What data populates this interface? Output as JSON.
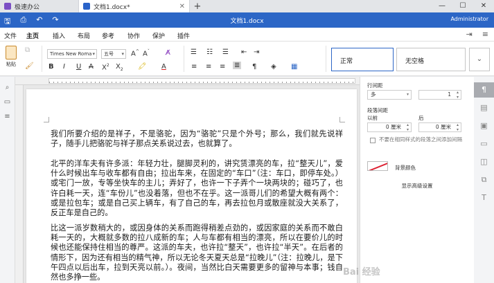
{
  "tabs": {
    "app_tab": "极速办公",
    "doc_tab": "文档1.docx*",
    "new_tab": "+"
  },
  "window": {
    "minimize": "—",
    "maximize": "☐",
    "close": "✕"
  },
  "titlebar": {
    "title": "文档1.docx",
    "user": "Administrator"
  },
  "menu": {
    "items": [
      "文件",
      "主页",
      "插入",
      "布局",
      "参考",
      "协作",
      "保护",
      "插件"
    ],
    "active_index": 1
  },
  "ribbon": {
    "paste_label": "粘贴",
    "font_name": "Times New Roma",
    "font_size": "五号",
    "style_normal": "正常",
    "style_no_spacing": "无空格"
  },
  "document": {
    "paragraphs": [
      "我们所要介绍的是祥子，不是骆驼，因为“骆驼”只是个外号；那么，我们就先说祥子，随手儿把骆驼与祥子那点关系说过去，也就算了。",
      "北平的洋车夫有许多派：年轻力壮，腿脚灵利的，讲究赁漂亮的车，拉“整天儿”，爱什么时候出车与收车都有自由；拉出车来，在固定的“车口”（注：车口，即停车处。）或宅门一放，专等坐快车的主儿；弄好了，也许一下子弄个一块两块的；碰巧了，也许白耗一天，连“车份儿”也没着落，但也不在乎。这一派哥儿们的希望大概有两个：或是拉包车；或是自己买上辆车，有了自己的车，再去拉包月或散座就没大关系了，反正车是自己的。",
      "比这一派岁数稍大的，或因身体的关系而跑得稍差点劲的，或因家庭的关系而不敢白耗一天的，大概就多数的拉八成新的车；人与车都有相当的漂亮，所以在要价儿的时候也还能保持住相当的尊严。这派的车夫，也许拉“整天”，也许拉“半天”。在后者的情形下，因为还有相当的精气神，所以无论冬天夏天总是“拉晚儿”（注：拉晚儿，是下午四点以后出车，拉到天亮以前。）。夜间，当然比白天需要更多的留神与本事；钱自然也多挣一些。"
    ]
  },
  "panel": {
    "line_spacing_label": "行间距",
    "line_spacing_mode": "多",
    "line_spacing_value": "1",
    "para_spacing_label": "段落间距",
    "before_label": "以前",
    "after_label": "后",
    "before_value": "0 厘米",
    "after_value": "0 厘米",
    "no_space_label": "不要在相同样式的段落之间添加间隔",
    "bg_color_label": "背景颜色",
    "advanced_label": "显示高级设置"
  },
  "watermark": "Bai 经验",
  "colors": {
    "titlebar": "#2c66c6",
    "accent": "#2c66c6"
  }
}
